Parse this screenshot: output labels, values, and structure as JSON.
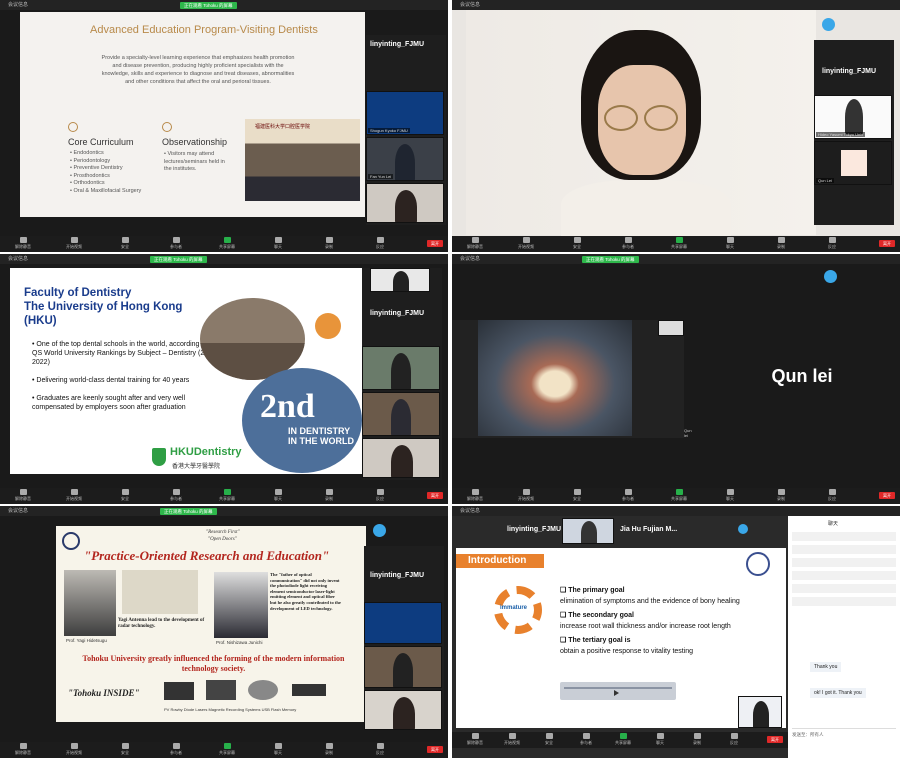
{
  "colors": {
    "zoom_bg": "#1a1a1a",
    "green": "#2eb84b",
    "end_red": "#e02828",
    "hku_blue": "#1a3c8c",
    "tohoku_red": "#b3261e",
    "intro_orange": "#e8812d"
  },
  "controls": {
    "labels": [
      "解除静音",
      "开始视频",
      "安全",
      "参与者",
      "共享屏幕",
      "聊天",
      "录制",
      "反应"
    ],
    "end_label": "离开"
  },
  "p1": {
    "title": "Advanced Education Program-Visiting Dentists",
    "body": "Provide a specialty-level learning experience that emphasizes health promotion and disease prevention, producing highly proficient specialists with the knowledge, skills and experience to diagnose and treat diseases, abnormalities and other conditions that affect the oral and perioral tissues.",
    "core_title": "Core Curriculum",
    "core_items": [
      "• Endodontics",
      "• Periodontology",
      "• Preventive Dentistry",
      "• Prosthodontics",
      "• Orthodontics",
      "• Oral & Maxillofacial Surgery"
    ],
    "obs_title": "Observationship",
    "obs_text": "• Visitors may attend lectures/seminars held in the institutes.",
    "side_name": "linyinting_FJMU",
    "tiles": [
      "Shogun Kyoko FJMU",
      "Fan Yun Lei",
      ""
    ],
    "photo_caption": "福建医科大学口腔医学院"
  },
  "p2": {
    "side_name": "linyinting_FJMU",
    "tiles": [
      "Yabuki Ohwaki",
      "Hideo Yasumi Tokyo Univ",
      "Qun Lei"
    ]
  },
  "p3": {
    "title": "Faculty of Dentistry\nThe University of Hong Kong\n(HKU)",
    "bullets": [
      "One of the top dental schools in the world, according to the QS World University Rankings by Subject – Dentistry (2nd in 2022)",
      "Delivering world-class dental training for 40 years",
      "Graduates are keenly sought after and very well compensated by employers soon after graduation"
    ],
    "rank": "2nd",
    "rank_sub": "IN DENTISTRY IN THE WORLD",
    "brand": "HKUDentistry",
    "brand_cn": "香港大學牙醫學院",
    "side_name": "linyinting_FJMU"
  },
  "p4": {
    "big_name": "Qun lei",
    "cap": "Qun lei"
  },
  "p5": {
    "heading": "\"Practice-Oriented Research and Education\"",
    "tagline1": "\"Research First\"",
    "tagline2": "\"Open Doors\"",
    "prof1": "Prof. Yagi Hidetsugu",
    "prof2": "Prof. Nishizawa Junichi",
    "yagi_caption": "Yagi Antenna lead to the development of radar technology.",
    "nishi_caption": "The \"father of optical communication\" did not only invent the photodiode light receiving element semiconductor laser-light emitting element and optical fiber but he also greatly contributed to the development of LED technology.",
    "claim": "Tohoku University greatly influenced the forming of the modern information technology society.",
    "inside": "\"Tohoku INSIDE\"",
    "devices": "PV Rowby Diode Lasers Magnetic Recording Systems USB Flash Memory",
    "side_name": "linyinting_FJMU"
  },
  "p6": {
    "top_name1": "linyinting_FJMU",
    "top_name2": "Jia Hu Fujian M...",
    "heading": "Introduction",
    "goals": [
      {
        "t": "The primary goal",
        "d": "elimination of symptoms and the evidence of bony healing"
      },
      {
        "t": "The secondary goal",
        "d": "increase root wall thickness and/or increase root length"
      },
      {
        "t": "The tertiary goal is",
        "d": "obtain a positive response to vitality testing"
      }
    ],
    "gear_label": "immature",
    "chat_title": "聊天",
    "chat_msgs": [
      "Thank you",
      "ok! I got it. Thank you"
    ],
    "chat_input": "发送至：所有人"
  }
}
